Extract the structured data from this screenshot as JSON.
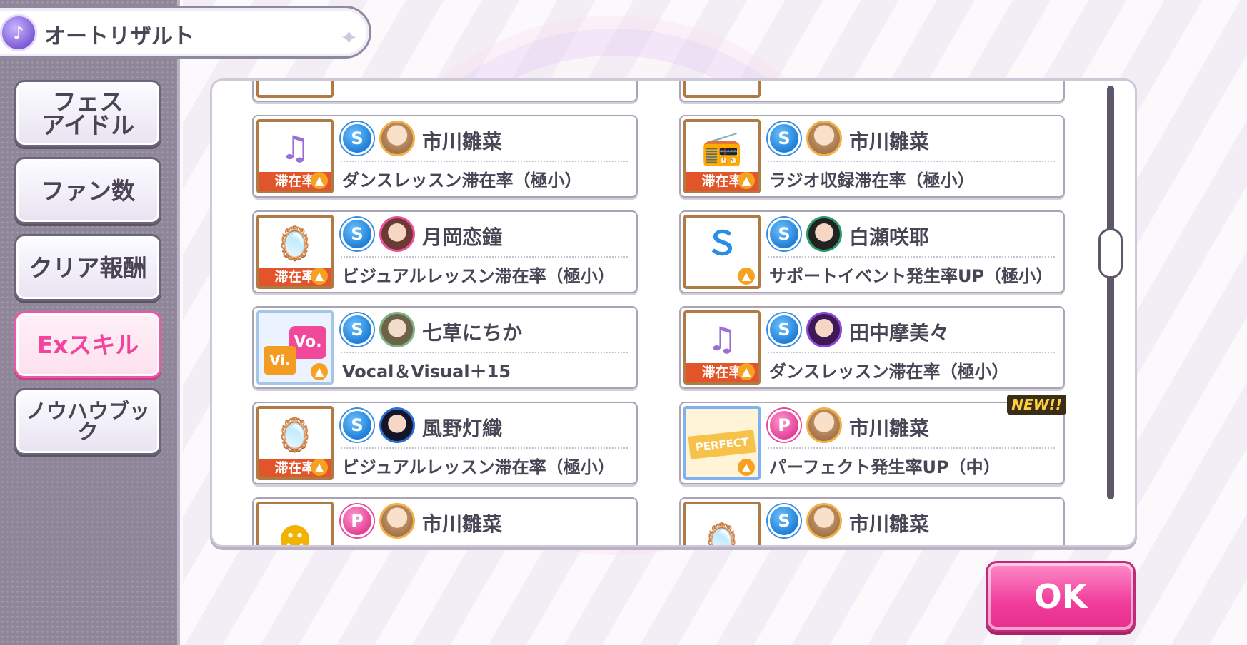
{
  "title_bar": {
    "title": "オートリザルト",
    "icon": "auto-result-icon"
  },
  "sidebar": {
    "items": [
      {
        "label": "フェス\nアイドル",
        "active": false
      },
      {
        "label": "ファン数",
        "active": false
      },
      {
        "label": "クリア報酬",
        "active": false
      },
      {
        "label": "Exスキル",
        "active": true
      },
      {
        "label": "ノウハウブック",
        "active": false
      }
    ]
  },
  "cards": [
    {
      "skill_type": "S",
      "idol": "市川雛菜",
      "skill": "ダンスレッスン滞在率（極小）",
      "thumb": "speaker",
      "badge": "滞在率",
      "new": false
    },
    {
      "skill_type": "S",
      "idol": "市川雛菜",
      "skill": "ラジオ収録滞在率（極小）",
      "thumb": "radio",
      "badge": "滞在率",
      "new": false
    },
    {
      "skill_type": "S",
      "idol": "月岡恋鐘",
      "skill": "ビジュアルレッスン滞在率（極小）",
      "thumb": "mirror",
      "badge": "滞在率",
      "new": false
    },
    {
      "skill_type": "S",
      "idol": "白瀬咲耶",
      "skill": "サポートイベント発生率UP（極小）",
      "thumb": "support",
      "badge": "",
      "new": false
    },
    {
      "skill_type": "S",
      "idol": "七草にちか",
      "skill": "Vocal＆Visual＋15",
      "thumb": "vovi",
      "badge": "",
      "thumb_labels": [
        "Vo.",
        "Vi."
      ],
      "new": false
    },
    {
      "skill_type": "S",
      "idol": "田中摩美々",
      "skill": "ダンスレッスン滞在率（極小）",
      "thumb": "speaker",
      "badge": "滞在率",
      "new": false
    },
    {
      "skill_type": "S",
      "idol": "風野灯織",
      "skill": "ビジュアルレッスン滞在率（極小）",
      "thumb": "mirror",
      "badge": "滞在率",
      "new": false
    },
    {
      "skill_type": "P",
      "idol": "市川雛菜",
      "skill": "パーフェクト発生率UP（中）",
      "thumb": "perfect",
      "badge": "",
      "thumb_label": "PERFECT",
      "new": true,
      "new_label": "NEW!!"
    },
    {
      "skill_type": "P",
      "idol": "市川雛菜",
      "skill": "",
      "thumb": "smile",
      "badge": "",
      "new": false
    },
    {
      "skill_type": "S",
      "idol": "市川雛菜",
      "skill": "",
      "thumb": "mirror",
      "badge": "",
      "new": false
    }
  ],
  "ok_button": {
    "label": "OK"
  },
  "colors": {
    "accent": "#f0449e",
    "badge": "#e2542a",
    "skill_blue": "#1f7fd8",
    "skill_pink": "#e53f96"
  }
}
